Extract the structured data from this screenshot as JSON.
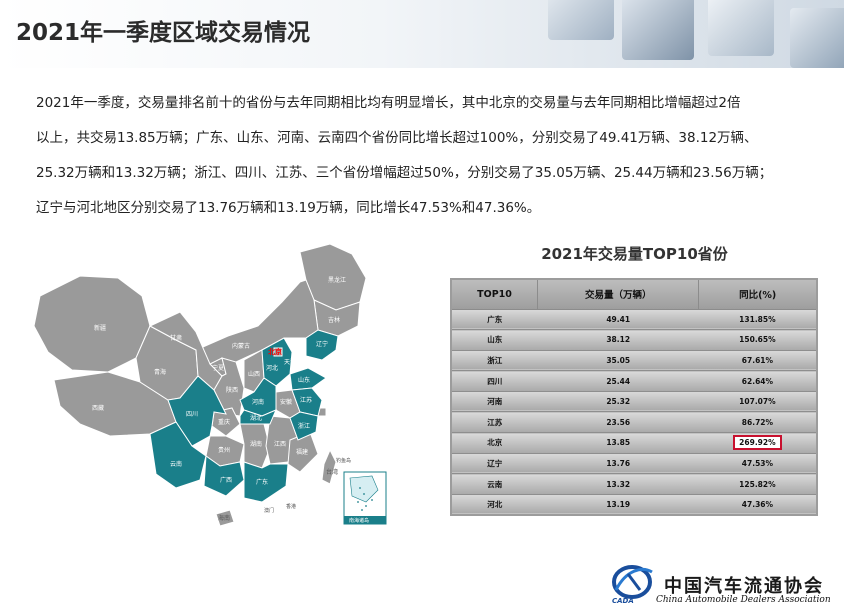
{
  "header": {
    "title": "2021年一季度区域交易情况"
  },
  "paragraph": {
    "lines": [
      "2021年一季度，交易量排名前十的省份与去年同期相比均有明显增长，其中北京的交易量与去年同期相比增幅超过2倍",
      "以上，共交易13.85万辆；广东、山东、河南、云南四个省份同比增长超过100%，分别交易了49.41万辆、38.12万辆、",
      "25.32万辆和13.32万辆；浙江、四川、江苏、三个省份增幅超过50%，分别交易了35.05万辆、25.44万辆和23.56万辆；",
      "辽宁与河北地区分别交易了13.76万辆和13.19万辆，同比增长47.53%和47.36%。"
    ]
  },
  "map": {
    "colors": {
      "highlight": "#1a7f8a",
      "base": "#9a9a9a",
      "beijing": "#ff0000"
    },
    "labels": {
      "heilongjiang": "黑龙江",
      "jilin": "吉林",
      "liaoning": "辽宁",
      "neimenggu": "内蒙古",
      "xinjiang": "新疆",
      "xizang": "西藏",
      "qinghai": "青海",
      "gansu": "甘肃",
      "ningxia": "宁夏",
      "shaanxi": "陕西",
      "shanxi": "山西",
      "hebei": "河北",
      "beijing": "北京",
      "tianjin": "天津",
      "shandong": "山东",
      "henan": "河南",
      "sichuan": "四川",
      "chongqing": "重庆",
      "hubei": "湖北",
      "anhui": "安徽",
      "jiangsu": "江苏",
      "shanghai": "上海",
      "zhejiang": "浙江",
      "jiangxi": "江西",
      "hunan": "湖南",
      "guizhou": "贵州",
      "yunnan": "云南",
      "guangxi": "广西",
      "guangdong": "广东",
      "fujian": "福建",
      "taiwan": "台湾",
      "hainan": "海南",
      "xianggang": "香港",
      "aomen": "澳门",
      "diaoyudao": "钓鱼岛",
      "nanhai": "南海诸岛"
    }
  },
  "table": {
    "title": "2021年交易量TOP10省份",
    "headers": [
      "TOP10",
      "交易量（万辆）",
      "同比(%)"
    ],
    "rows": [
      {
        "province": "广东",
        "volume": "49.41",
        "yoy": "131.85%"
      },
      {
        "province": "山东",
        "volume": "38.12",
        "yoy": "150.65%"
      },
      {
        "province": "浙江",
        "volume": "35.05",
        "yoy": "67.61%"
      },
      {
        "province": "四川",
        "volume": "25.44",
        "yoy": "62.64%"
      },
      {
        "province": "河南",
        "volume": "25.32",
        "yoy": "107.07%"
      },
      {
        "province": "江苏",
        "volume": "23.56",
        "yoy": "86.72%"
      },
      {
        "province": "北京",
        "volume": "13.85",
        "yoy": "269.92%",
        "highlight": true
      },
      {
        "province": "辽宁",
        "volume": "13.76",
        "yoy": "47.53%"
      },
      {
        "province": "云南",
        "volume": "13.32",
        "yoy": "125.82%"
      },
      {
        "province": "河北",
        "volume": "13.19",
        "yoy": "47.36%"
      }
    ]
  },
  "logo": {
    "chinese": "中国汽车流通协会",
    "english": "China Automobile Dealers Association",
    "abbr": "CADA"
  }
}
